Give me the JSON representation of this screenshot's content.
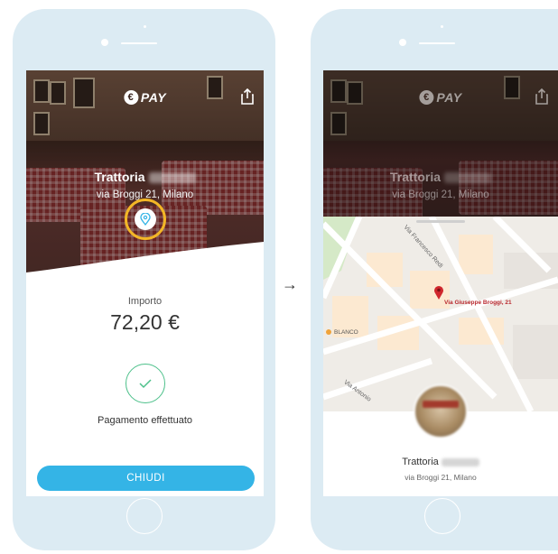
{
  "arrow": "→",
  "payment_screen": {
    "logo_text": "PAY",
    "restaurant_name": "Trattoria",
    "restaurant_address": "via Broggi 21, Milano",
    "amount_label": "Importo",
    "amount_value": "72,20 €",
    "status_text": "Pagamento effettuato",
    "close_button_label": "CHIUDI"
  },
  "map_screen": {
    "logo_text": "PAY",
    "restaurant_name": "Trattoria",
    "restaurant_address": "via Broggi 21, Milano",
    "map": {
      "street_labels": [
        "Via Francesco Redi",
        "Via Antonio"
      ],
      "pin_address": "Via Giuseppe Broggi, 21",
      "poi_label": "BLANCO"
    }
  },
  "colors": {
    "phone_frame": "#dcebf3",
    "accent_blue": "#34b4e6",
    "highlight_ring": "#f3b626",
    "success_green": "#4cc08a",
    "map_pin": "#d0272d"
  }
}
